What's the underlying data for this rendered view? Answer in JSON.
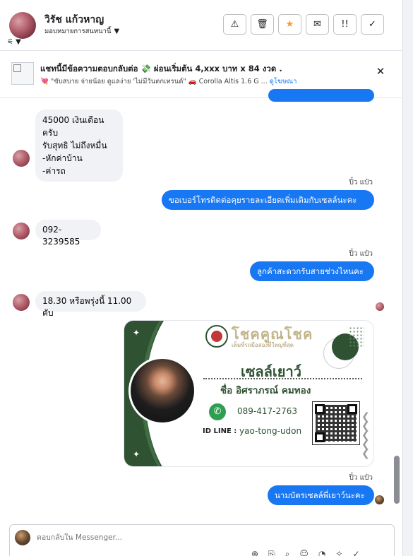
{
  "header": {
    "contact_name": "วิรัช แก้วหาญ",
    "assign_label": "มอบหมายการสนทนานี้",
    "actions": [
      {
        "name": "report-spam-button",
        "icon": "⚠"
      },
      {
        "name": "delete-button",
        "icon": "🗑"
      },
      {
        "name": "star-button",
        "icon": "★"
      },
      {
        "name": "mark-unread-button",
        "icon": "✉"
      },
      {
        "name": "follow-up-button",
        "icon": "!!"
      },
      {
        "name": "mark-done-button",
        "icon": "✓"
      }
    ]
  },
  "ad": {
    "title": "แชทนี้มีข้อความตอบกลับต่อ 💸 ผ่อนเริ่มต้น 4,xxx บาท x 84 งวด .",
    "subtitle": "💘 \"ขับสบาย จ่ายน้อย ดูแลง่าย 'ไม่มีวันตกเทรนด์\" 🚗 Corolla Altis 1.6 G ...",
    "link": "ดูโฆษณา"
  },
  "messages": {
    "m1": "45000 เงินเดือนครับ\nรับสุทธิ ไม่ถึงหมื่น\n-หักค่าบ้าน\n-ค่ารถ",
    "sender1": "ปิ๋ว แป๋ว",
    "m2": "ขอเบอร์โทรติดต่อคุยรายละเอียดเพิ่มเติมกับเซลล์นะคะ",
    "m3": "092-3239585",
    "sender2": "ปิ๋ว แป๋ว",
    "m4": "ลูกค้าสะดวกรับสายช่วงไหนคะ",
    "m5": "18.30 หรือพรุ่งนี้ 11.00 คับ",
    "sender3": "ปิ๋ว แป๋ว",
    "m6": "นามบัตรเซลล์พี่เยาว์นะคะ"
  },
  "card": {
    "brand": "โชคคูณโชค",
    "brand_sub": "เต็มที่รถมือสองที่ใหญ่ที่สุด",
    "nickname": "เซลล์เยาว์",
    "fullname": "ชื่อ อิศราภรณ์ คมทอง",
    "phone": "089-417-2763",
    "line_label": "ID LINE :",
    "line_id": "yao-tong-udon"
  },
  "composer": {
    "placeholder": "ตอบกลับใน Messenger..."
  }
}
